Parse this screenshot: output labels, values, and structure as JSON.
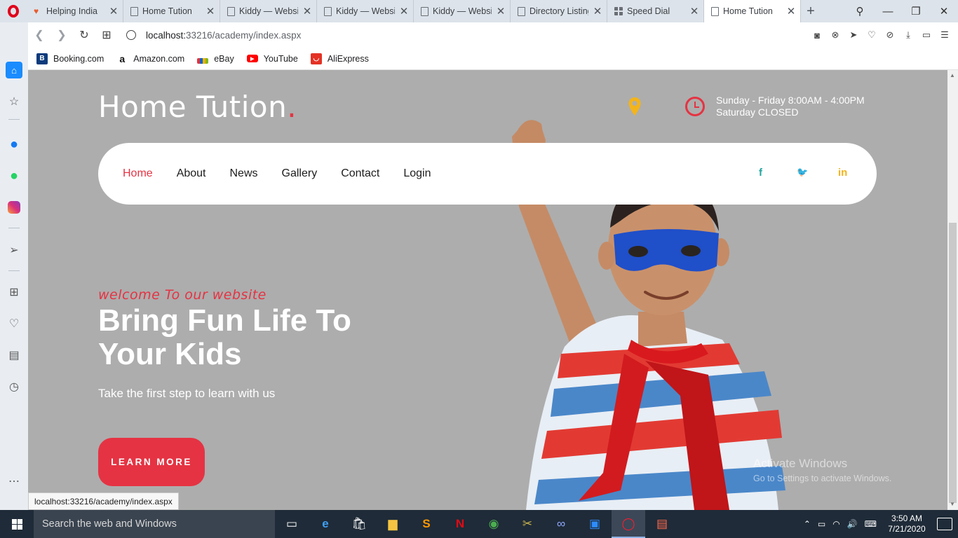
{
  "browser": {
    "tabs": [
      {
        "title": "Helping India",
        "icon": "heart"
      },
      {
        "title": "Home Tution",
        "icon": "page"
      },
      {
        "title": "Kiddy — Websit",
        "icon": "page"
      },
      {
        "title": "Kiddy — Websit",
        "icon": "page"
      },
      {
        "title": "Kiddy — Websit",
        "icon": "page"
      },
      {
        "title": "Directory Listing",
        "icon": "page"
      },
      {
        "title": "Speed Dial",
        "icon": "grid"
      },
      {
        "title": "Home Tution",
        "icon": "page"
      }
    ],
    "url_host": "localhost:",
    "url_rest": "33216/academy/index.aspx",
    "status_url": "localhost:33216/academy/index.aspx",
    "bookmarks": [
      {
        "label": "Booking.com",
        "icon": "booking-icon",
        "color": "#0c3b7c",
        "glyph": "B"
      },
      {
        "label": "Amazon.com",
        "icon": "amazon-icon",
        "color": "#ffffff",
        "glyph": "a"
      },
      {
        "label": "eBay",
        "icon": "ebay-icon",
        "color": "#e53238",
        "glyph": ""
      },
      {
        "label": "YouTube",
        "icon": "youtube-icon",
        "color": "#ff0000",
        "glyph": "▶"
      },
      {
        "label": "AliExpress",
        "icon": "aliexpress-icon",
        "color": "#e43225",
        "glyph": "◡"
      }
    ]
  },
  "site": {
    "logo_text": "Home Tution",
    "logo_dot": ".",
    "hours_line1": "Sunday - Friday 8:00AM - 4:00PM",
    "hours_line2": "Saturday CLOSED",
    "nav": [
      "Home",
      "About",
      "News",
      "Gallery",
      "Contact",
      "Login"
    ],
    "social": {
      "facebook": "f",
      "twitter": "🐦",
      "linkedin": "in"
    },
    "welcome": "welcome To our website",
    "headline_1": "Bring Fun Life To",
    "headline_2": "Your Kids",
    "subtitle": "Take the first step to learn with us",
    "cta": "LEARN MORE"
  },
  "watermark": {
    "line1": "Activate Windows",
    "line2": "Go to Settings to activate Windows."
  },
  "taskbar": {
    "search_placeholder": "Search the web and Windows",
    "time": "3:50 AM",
    "date": "7/21/2020"
  },
  "colors": {
    "accent_red": "#e53343",
    "page_bg": "#adadad",
    "pin_yellow": "#f4b41a",
    "facebook": "#22a6a0",
    "twitter": "#6cc04a",
    "linkedin": "#f4b41a"
  }
}
